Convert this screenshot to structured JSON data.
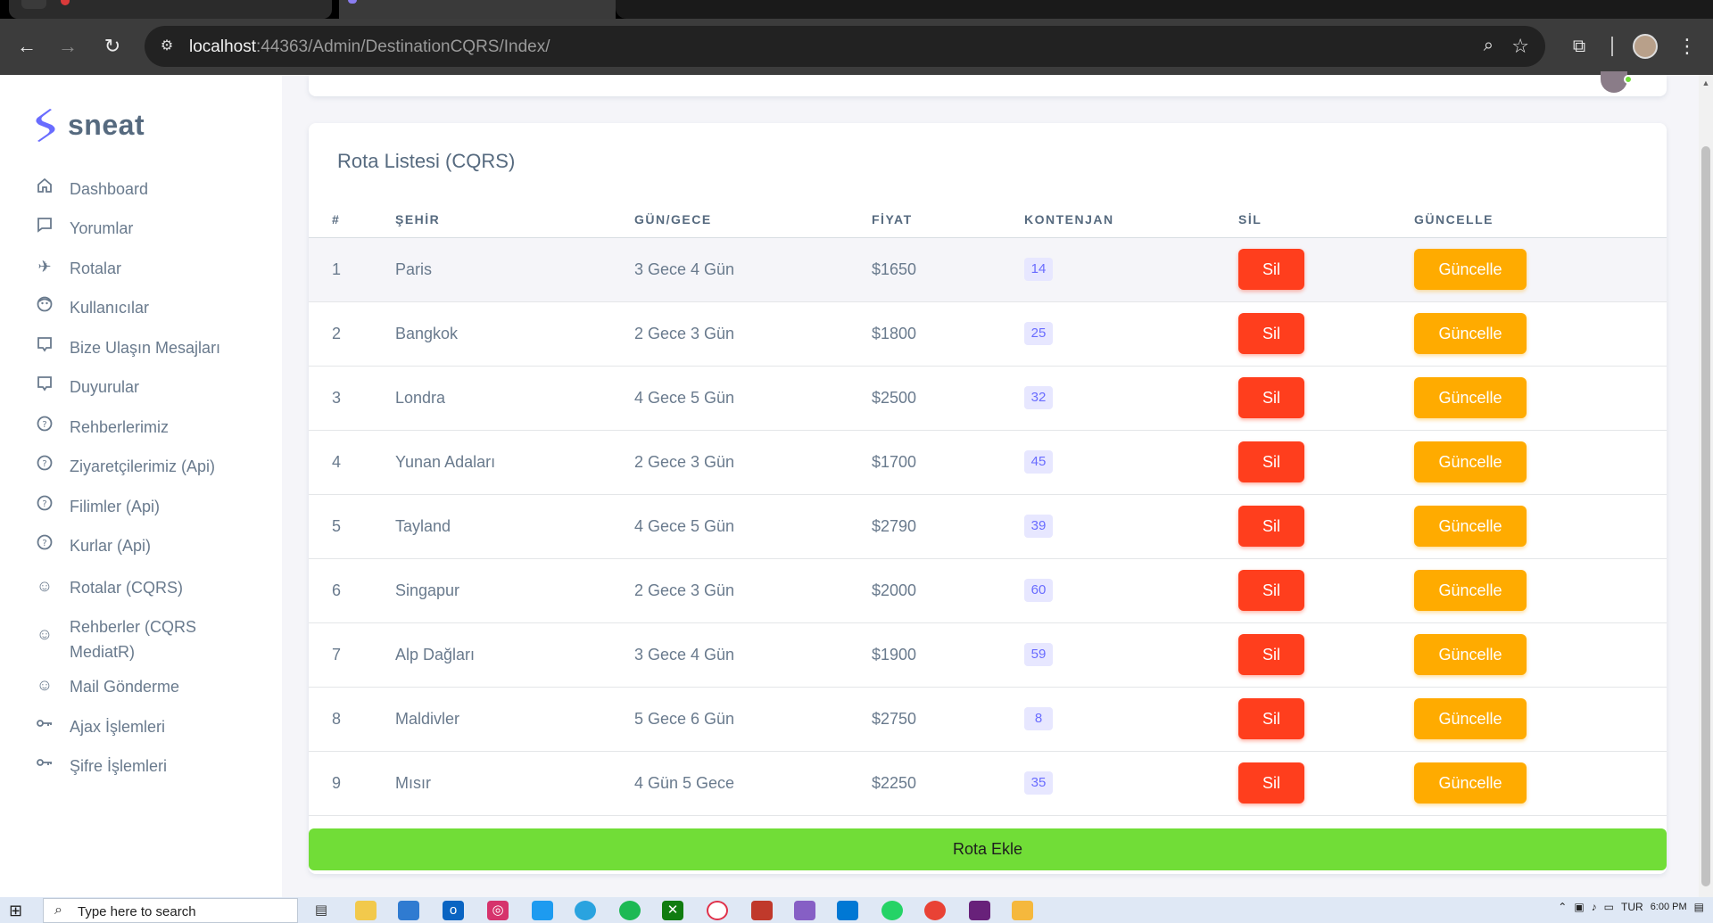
{
  "browser": {
    "url_host": "localhost",
    "url_rest": ":44363/Admin/DestinationCQRS/Index/"
  },
  "brand": {
    "name": "sneat"
  },
  "sidebar": {
    "items": [
      {
        "label": "Dashboard",
        "icon": "home-icon"
      },
      {
        "label": "Yorumlar",
        "icon": "comment-icon"
      },
      {
        "label": "Rotalar",
        "icon": "plane-icon"
      },
      {
        "label": "Kullanıcılar",
        "icon": "user-face-icon"
      },
      {
        "label": "Bize Ulaşın Mesajları",
        "icon": "message-icon"
      },
      {
        "label": "Duyurular",
        "icon": "message-icon"
      },
      {
        "label": "Rehberlerimiz",
        "icon": "help-circle-icon"
      },
      {
        "label": "Ziyaretçilerimiz (Api)",
        "icon": "help-circle-icon"
      },
      {
        "label": "Filimler (Api)",
        "icon": "help-circle-icon"
      },
      {
        "label": "Kurlar (Api)",
        "icon": "help-circle-icon"
      },
      {
        "label": "Rotalar (CQRS)",
        "icon": "mail-chimp-icon"
      },
      {
        "label": "Rehberler (CQRS MediatR)",
        "icon": "mail-chimp-icon"
      },
      {
        "label": "Mail Gönderme",
        "icon": "mail-chimp-icon"
      },
      {
        "label": "Ajax İşlemleri",
        "icon": "key-icon"
      },
      {
        "label": "Şifre İşlemleri",
        "icon": "key-icon"
      }
    ]
  },
  "card": {
    "title": "Rota Listesi (CQRS)",
    "columns": [
      "#",
      "ŞEHİR",
      "GÜN/GECE",
      "FİYAT",
      "KONTENJAN",
      "SİL",
      "GÜNCELLE"
    ],
    "rows": [
      {
        "id": "1",
        "city": "Paris",
        "duration": "3 Gece 4 Gün",
        "price": "$1650",
        "capacity": "14"
      },
      {
        "id": "2",
        "city": "Bangkok",
        "duration": "2 Gece 3 Gün",
        "price": "$1800",
        "capacity": "25"
      },
      {
        "id": "3",
        "city": "Londra",
        "duration": "4 Gece 5 Gün",
        "price": "$2500",
        "capacity": "32"
      },
      {
        "id": "4",
        "city": "Yunan Adaları",
        "duration": "2 Gece 3 Gün",
        "price": "$1700",
        "capacity": "45"
      },
      {
        "id": "5",
        "city": "Tayland",
        "duration": "4 Gece 5 Gün",
        "price": "$2790",
        "capacity": "39"
      },
      {
        "id": "6",
        "city": "Singapur",
        "duration": "2 Gece 3 Gün",
        "price": "$2000",
        "capacity": "60"
      },
      {
        "id": "7",
        "city": "Alp Dağları",
        "duration": "3 Gece 4 Gün",
        "price": "$1900",
        "capacity": "59"
      },
      {
        "id": "8",
        "city": "Maldivler",
        "duration": "5 Gece 6 Gün",
        "price": "$2750",
        "capacity": "8"
      },
      {
        "id": "9",
        "city": "Mısır",
        "duration": "4 Gün 5 Gece",
        "price": "$2250",
        "capacity": "35"
      }
    ],
    "delete_label": "Sil",
    "update_label": "Güncelle",
    "add_label": "Rota Ekle"
  },
  "colors": {
    "delete": "#ff3e1d",
    "update": "#ffab00",
    "add": "#71dd37",
    "badge": "#696cff"
  },
  "taskbar": {
    "search_placeholder": "Type here to search",
    "time": "6:00 PM",
    "language": "TUR"
  }
}
